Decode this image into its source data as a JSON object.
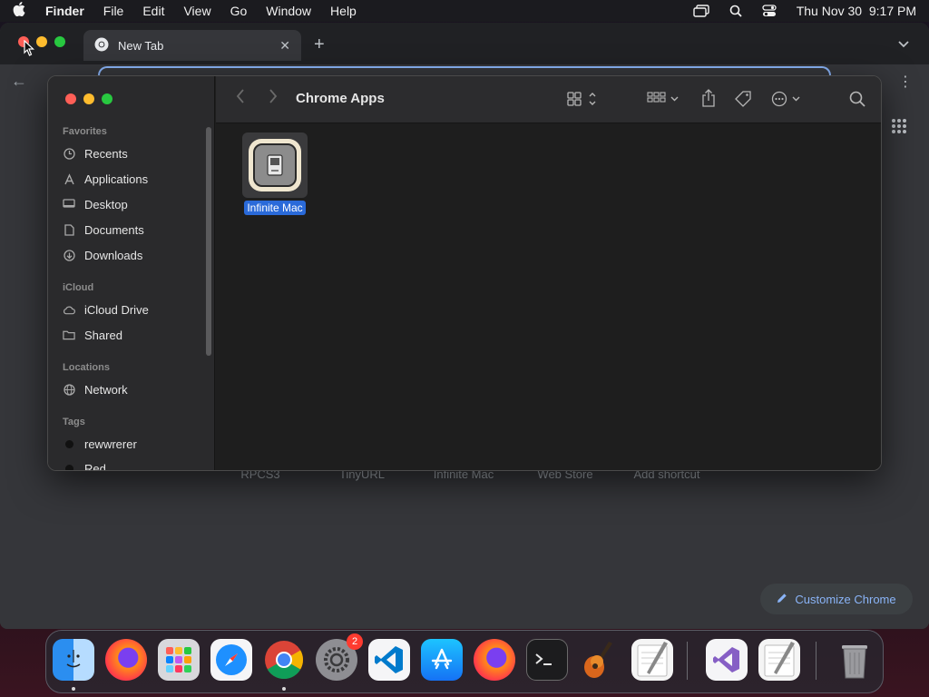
{
  "menubar": {
    "app_name": "Finder",
    "items": [
      "File",
      "Edit",
      "View",
      "Go",
      "Window",
      "Help"
    ],
    "clock": "Thu Nov 30  9:17 PM"
  },
  "chrome": {
    "tab_title": "New Tab",
    "shortcut_labels": [
      "RPCS3",
      "TinyURL",
      "Infinite Mac",
      "Web Store",
      "Add shortcut"
    ],
    "customize_label": "Customize Chrome",
    "accent_color": "#8ab4f8"
  },
  "finder": {
    "title": "Chrome Apps",
    "sidebar": {
      "favorites_label": "Favorites",
      "favorites": [
        {
          "label": "Recents",
          "icon": "clock-icon"
        },
        {
          "label": "Applications",
          "icon": "applications-icon"
        },
        {
          "label": "Desktop",
          "icon": "desktop-icon"
        },
        {
          "label": "Documents",
          "icon": "document-icon"
        },
        {
          "label": "Downloads",
          "icon": "download-icon"
        }
      ],
      "icloud_label": "iCloud",
      "icloud": [
        {
          "label": "iCloud Drive",
          "icon": "cloud-icon"
        },
        {
          "label": "Shared",
          "icon": "shared-folder-icon"
        }
      ],
      "locations_label": "Locations",
      "locations": [
        {
          "label": "Network",
          "icon": "globe-icon"
        }
      ],
      "tags_label": "Tags",
      "tags": [
        {
          "label": "rewwrerer",
          "color": "#111111"
        },
        {
          "label": "Red",
          "color": "#111111"
        }
      ]
    },
    "files": [
      {
        "label": "Infinite Mac",
        "selected": true
      }
    ],
    "selection_color": "#2a6ad9"
  },
  "dock": {
    "apps": [
      {
        "name": "Finder",
        "icon": "finder-icon",
        "running": true
      },
      {
        "name": "Firefox",
        "icon": "firefox-icon",
        "running": false
      },
      {
        "name": "Launchpad",
        "icon": "launchpad-icon",
        "running": false
      },
      {
        "name": "Safari",
        "icon": "safari-icon",
        "running": false
      },
      {
        "name": "Google Chrome",
        "icon": "chrome-icon",
        "running": true
      },
      {
        "name": "System Settings",
        "icon": "settings-icon",
        "running": false,
        "badge": "2"
      },
      {
        "name": "Visual Studio Code",
        "icon": "vscode-icon",
        "running": false
      },
      {
        "name": "App Store",
        "icon": "app-store-icon",
        "running": false
      },
      {
        "name": "Firefox",
        "icon": "firefox-icon",
        "running": false
      },
      {
        "name": "Terminal",
        "icon": "terminal-icon",
        "running": false
      },
      {
        "name": "GarageBand",
        "icon": "garageband-icon",
        "running": false
      },
      {
        "name": "TextEdit",
        "icon": "textedit-icon",
        "running": false
      },
      {
        "name": "Visual Studio",
        "icon": "visual-studio-icon",
        "running": false
      },
      {
        "name": "TextEdit",
        "icon": "textedit-icon",
        "running": false
      },
      {
        "name": "Trash",
        "icon": "trash-icon",
        "running": false
      }
    ]
  }
}
